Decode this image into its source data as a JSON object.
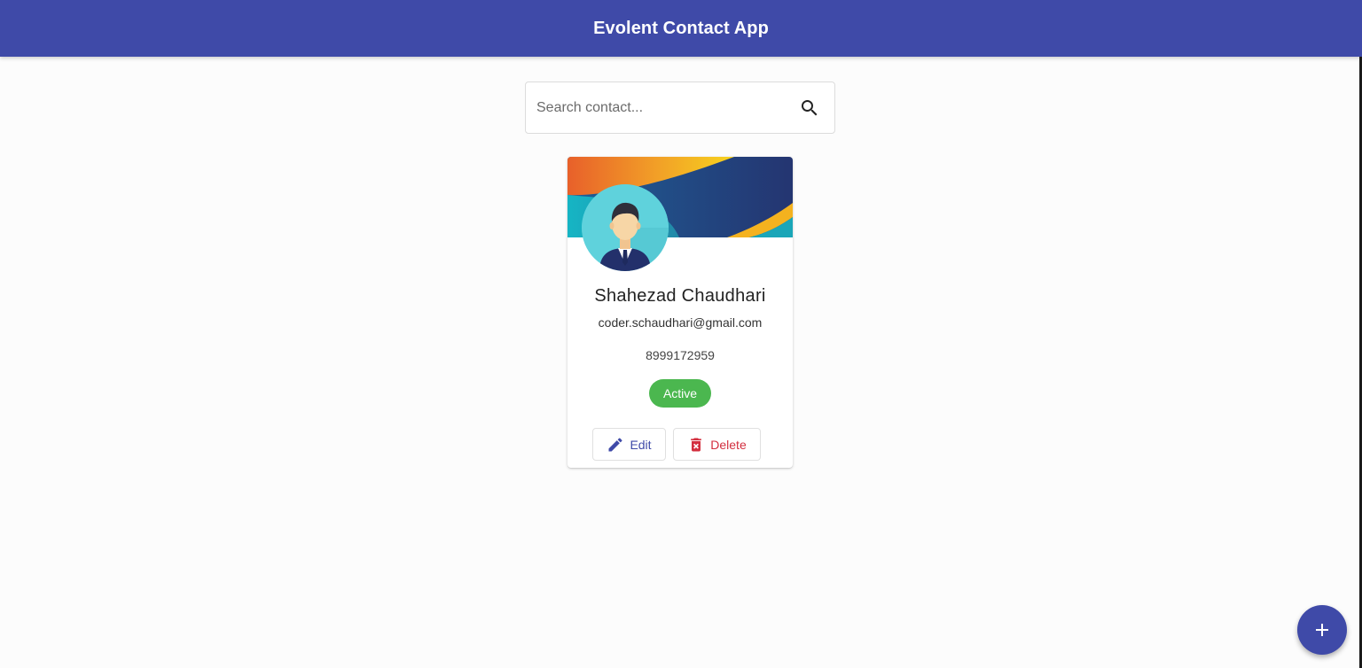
{
  "header": {
    "title": "Evolent Contact App"
  },
  "search": {
    "placeholder": "Search contact...",
    "value": "",
    "icon": "search-icon"
  },
  "contacts": [
    {
      "name": "Shahezad Chaudhari",
      "email": "coder.schaudhari@gmail.com",
      "phone": "8999172959",
      "status": "Active",
      "avatar": "businessman-avatar",
      "actions": {
        "edit_label": "Edit",
        "delete_label": "Delete"
      }
    }
  ],
  "fab": {
    "icon": "plus-icon"
  },
  "colors": {
    "primary": "#3f4aa8",
    "active": "#4bb74f",
    "delete": "#d32f3f",
    "background": "#fcfcfc"
  }
}
